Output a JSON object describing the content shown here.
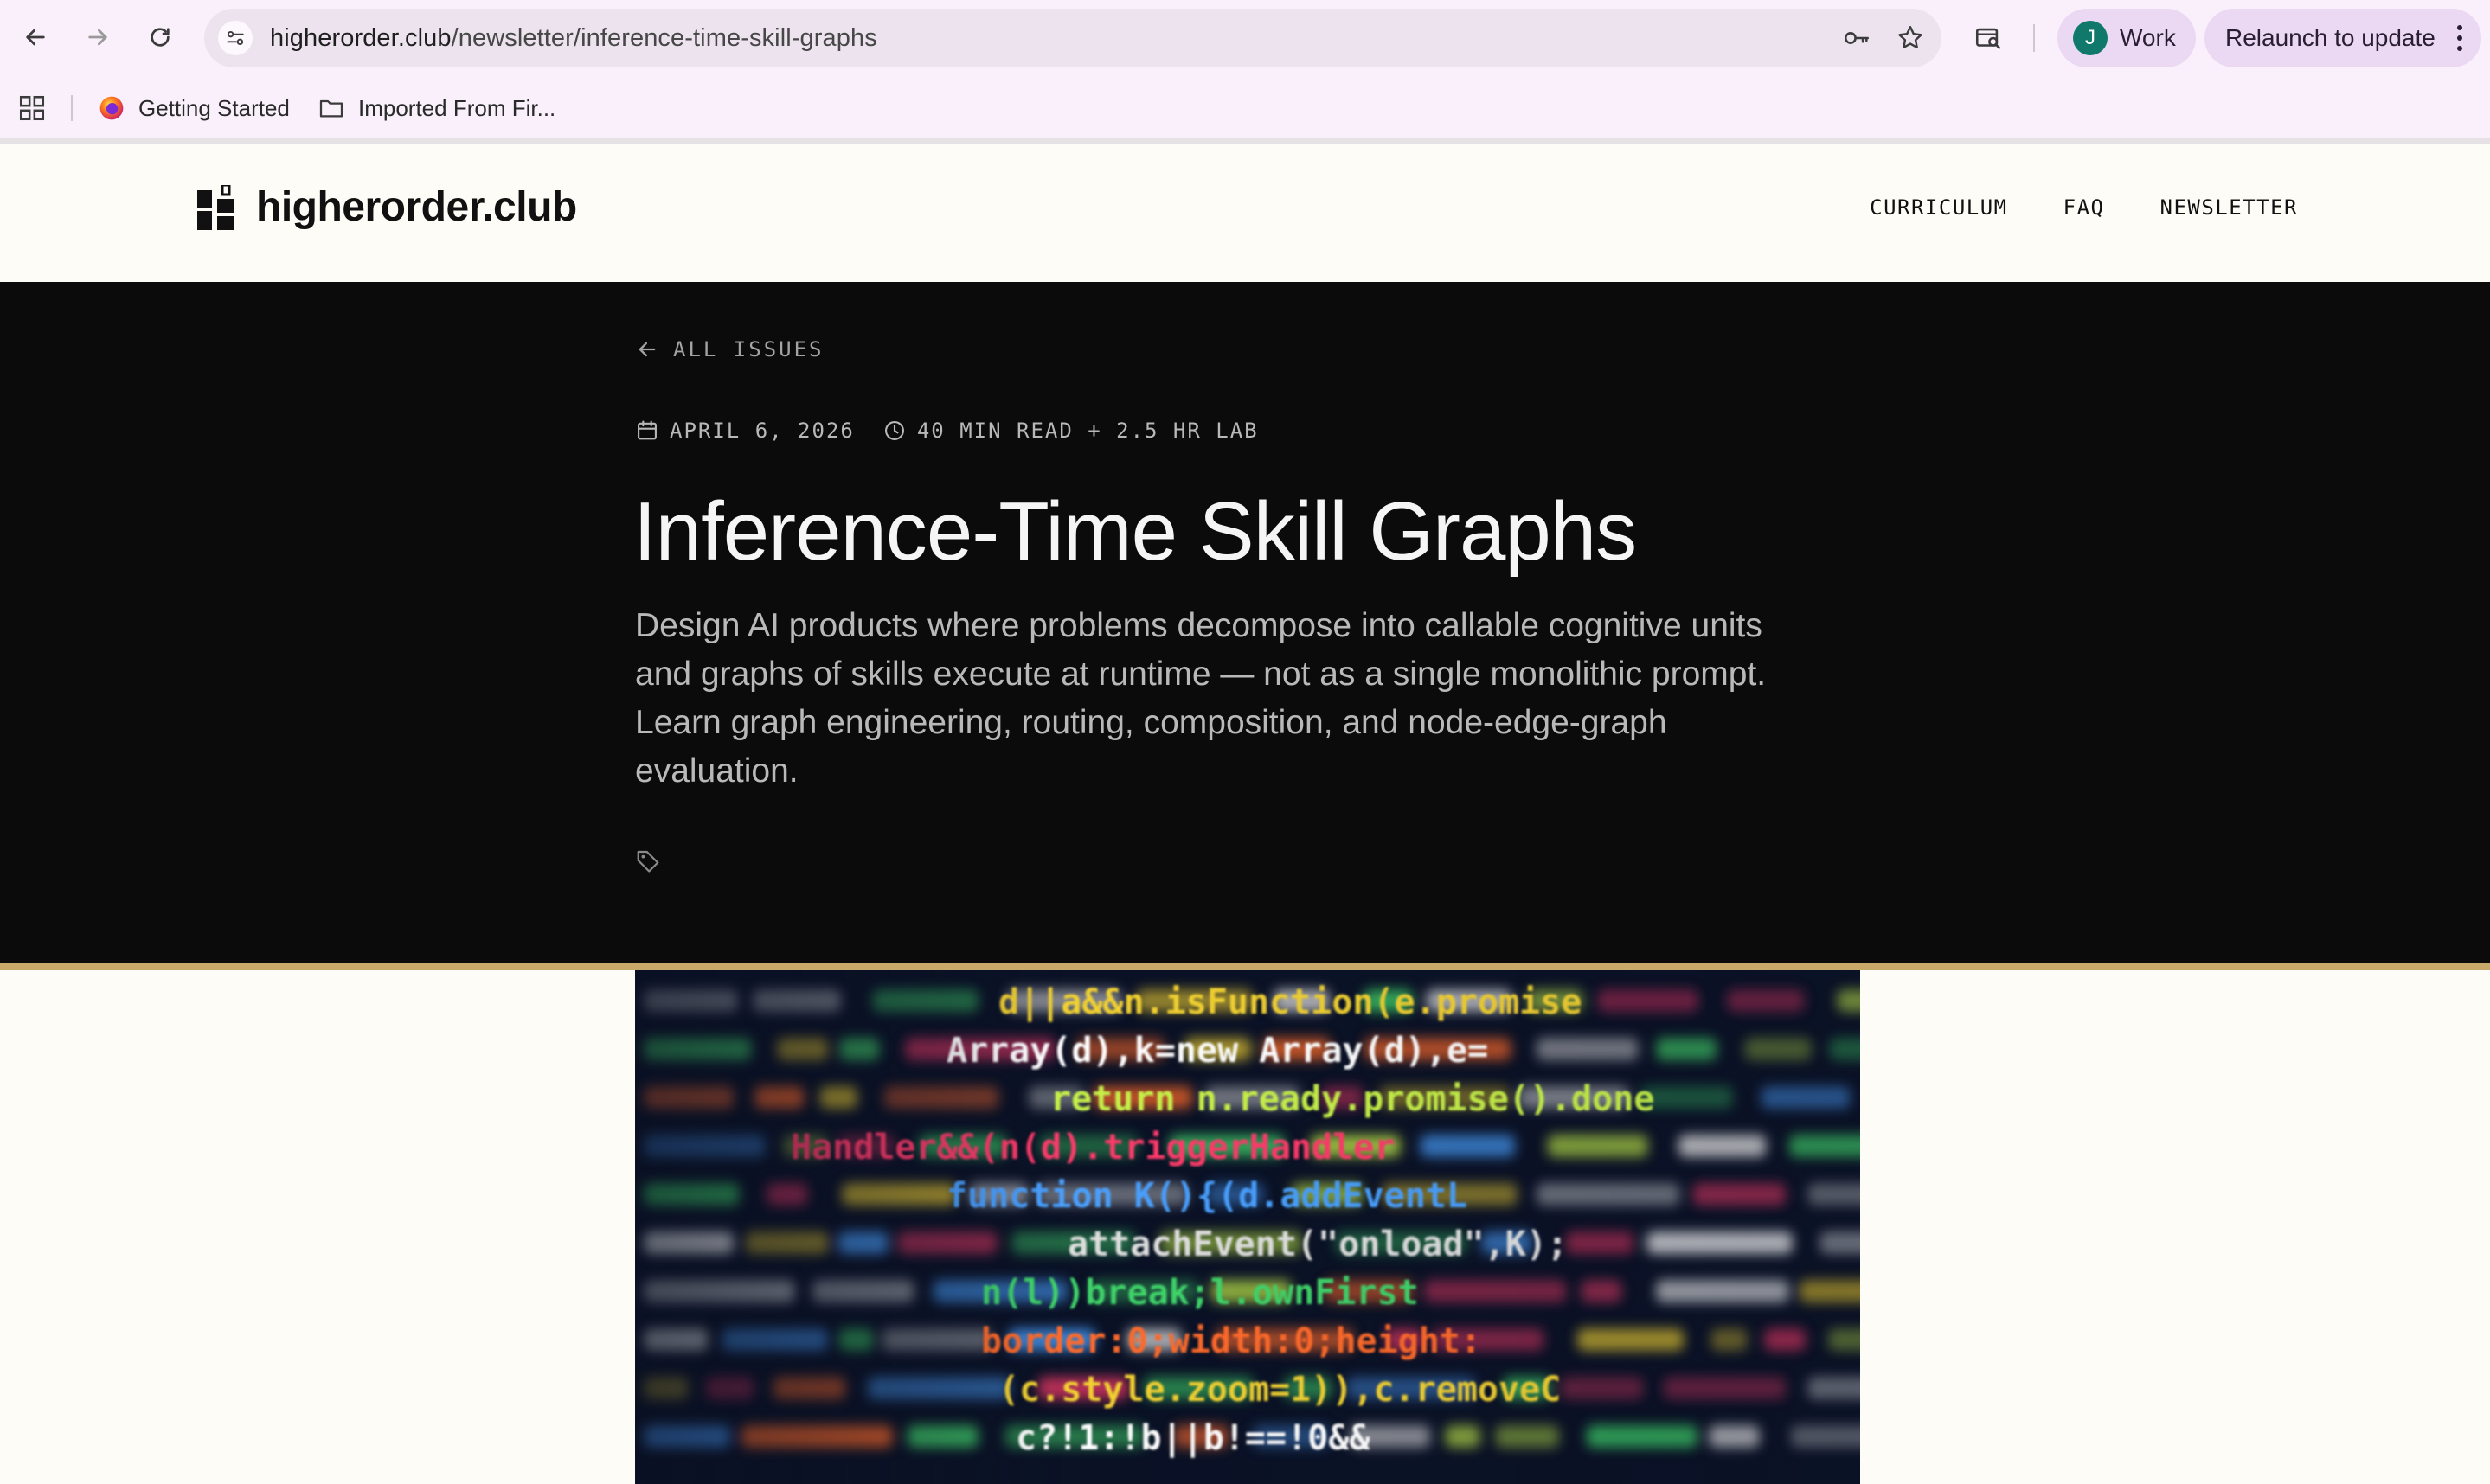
{
  "browser": {
    "url_host": "higherorder.club",
    "url_path": "/newsletter/inference-time-skill-graphs",
    "profile_initial": "J",
    "profile_label": "Work",
    "relaunch_label": "Relaunch to update",
    "bookmarks": [
      {
        "label": "Getting Started",
        "icon": "firefox-icon"
      },
      {
        "label": "Imported From Fir...",
        "icon": "folder-icon"
      }
    ]
  },
  "site": {
    "logo_text": "higherorder.club",
    "nav": [
      {
        "label": "CURRICULUM"
      },
      {
        "label": "FAQ"
      },
      {
        "label": "NEWSLETTER"
      }
    ]
  },
  "article": {
    "back_label": "ALL ISSUES",
    "date": "APRIL 6, 2026",
    "read_time": "40 MIN READ + 2.5 HR LAB",
    "title": "Inference-Time Skill Graphs",
    "subtitle": "Design AI products where problems decompose into callable cognitive units and graphs of skills execute at runtime — not as a single monolithic prompt. Learn graph engineering, routing, composition, and node-edge-graph evaluation.",
    "code_lines": [
      "d||a&&n.isFunction(e.promise",
      "Array(d),k=new Array(d),e=",
      "return n.ready.promise().done",
      "Handler&&(n(d).triggerHandler",
      "function K(){(d.addEventL",
      "attachEvent(\"onload\",K);",
      "n(l))break;l.ownFirst",
      "border:0;width:0;height:",
      "(c.style.zoom=1)),c.removeC",
      "c?!1:!b||b!==!0&&"
    ]
  },
  "colors": {
    "hero_bg": "#0b0b0b",
    "accent_gold": "#c8a96a",
    "page_bg": "#fdfcf7",
    "chrome_bg": "#f9f0fb",
    "profile_green": "#10796b"
  }
}
